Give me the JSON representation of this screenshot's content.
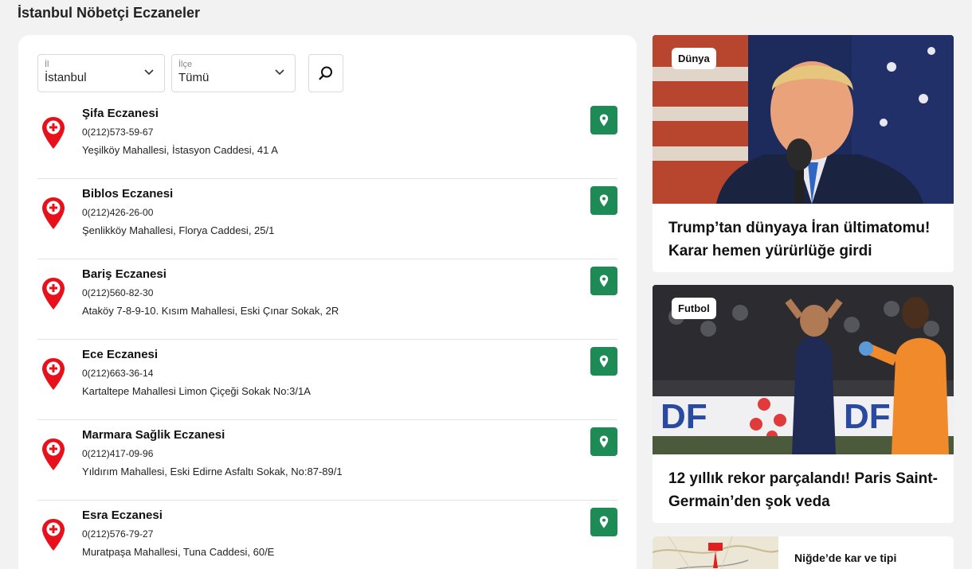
{
  "page_title": "İstanbul Nöbetçi Eczaneler",
  "filters": {
    "il_label": "İl",
    "il_value": "İstanbul",
    "ilce_label": "İlçe",
    "ilce_value": "Tümü"
  },
  "pharmacies": [
    {
      "name": "Şifa Eczanesi",
      "phone": "0(212)573-59-67",
      "address": "Yeşilköy Mahallesi, İstasyon Caddesi, 41 A"
    },
    {
      "name": "Biblos Eczanesi",
      "phone": "0(212)426-26-00",
      "address": "Şenlikköy Mahallesi, Florya Caddesi, 25/1"
    },
    {
      "name": "Bariş Eczanesi",
      "phone": "0(212)560-82-30",
      "address": "Ataköy 7-8-9-10. Kısım Mahallesi, Eski Çınar Sokak, 2R"
    },
    {
      "name": "Ece Eczanesi",
      "phone": "0(212)663-36-14",
      "address": "Kartaltepe Mahallesi Limon Çiçeği Sokak No:3/1A"
    },
    {
      "name": "Marmara Sağlik Eczanesi",
      "phone": "0(212)417-09-96",
      "address": "Yıldırım Mahallesi, Eski Edirne Asfaltı Sokak, No:87-89/1"
    },
    {
      "name": "Esra Eczanesi",
      "phone": "0(212)576-79-27",
      "address": "Muratpaşa Mahallesi, Tuna Caddesi, 60/E"
    }
  ],
  "news": [
    {
      "category": "Dünya",
      "title": "Trump’tan dünyaya İran ültimatomu! Karar hemen yürürlüğe girdi"
    },
    {
      "category": "Futbol",
      "title": "12 yıllık rekor parçalandı! Paris Saint-Germain’den şok veda"
    },
    {
      "title": "Niğde’de kar ve tipi"
    }
  ],
  "colors": {
    "pin": "#e8101a",
    "map_button": "#1e8a55"
  }
}
